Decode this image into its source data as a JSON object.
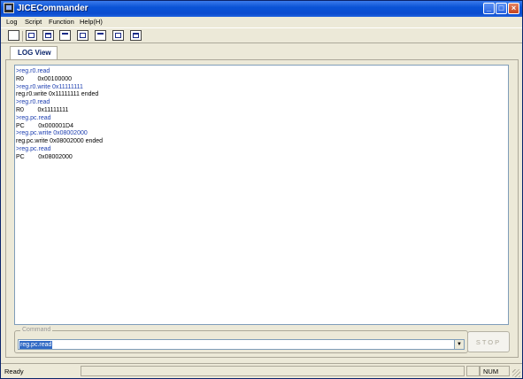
{
  "window": {
    "title": "JICECommander",
    "controls": [
      "minimize-icon",
      "maximize-icon",
      "close-icon"
    ]
  },
  "menu": {
    "items": [
      "Log",
      "Script",
      "Function",
      "Help(H)"
    ]
  },
  "toolbar": {
    "buttons": [
      "new-icon",
      "save-icon",
      "register-icon",
      "memory-icon",
      "disassembly-icon",
      "breakpoint-icon",
      "reset-icon",
      "settings-icon"
    ]
  },
  "tabs": {
    "active": "LOG View"
  },
  "log": {
    "lines": [
      {
        "text": ">reg.r0.read",
        "kind": "cmd"
      },
      {
        "text": "R0        0x00100000",
        "kind": "out"
      },
      {
        "text": ">reg.r0.write 0x11111111",
        "kind": "cmd"
      },
      {
        "text": "reg.r0.write 0x11111111 ended",
        "kind": "out"
      },
      {
        "text": ">reg.r0.read",
        "kind": "cmd"
      },
      {
        "text": "R0        0x11111111",
        "kind": "out"
      },
      {
        "text": ">reg.pc.read",
        "kind": "cmd"
      },
      {
        "text": "PC        0x000001D4",
        "kind": "out"
      },
      {
        "text": ">reg.pc.write 0x08002000",
        "kind": "cmd"
      },
      {
        "text": "reg.pc.write 0x08002000 ended",
        "kind": "out"
      },
      {
        "text": ">reg.pc.read",
        "kind": "cmd"
      },
      {
        "text": "PC        0x08002000",
        "kind": "out"
      }
    ]
  },
  "command": {
    "label": "Command",
    "value": "reg.pc.read",
    "stop_label": "STOP"
  },
  "status": {
    "text": "Ready",
    "num": "NUM"
  },
  "colors": {
    "command_text": "#1e3fb0",
    "selection": "#316ac5",
    "titlebar": "#0a53d6"
  }
}
